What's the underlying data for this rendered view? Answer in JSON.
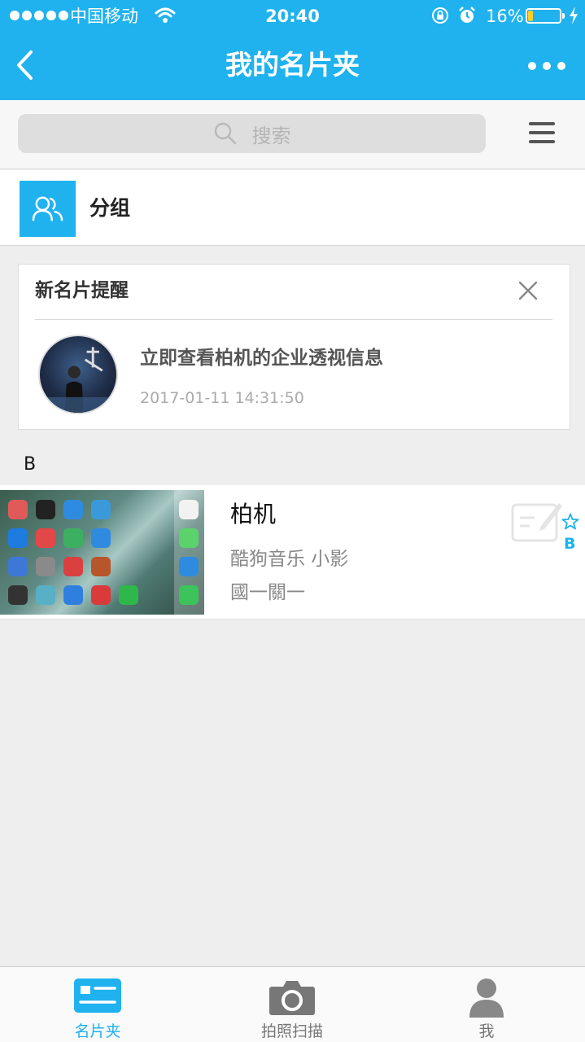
{
  "status_bar": {
    "carrier": "中国移动",
    "time": "20:40",
    "battery_text": "16%",
    "battery_level": 0.16
  },
  "nav": {
    "title": "我的名片夹"
  },
  "search": {
    "placeholder": "搜索"
  },
  "group": {
    "label": "分组"
  },
  "reminder": {
    "title": "新名片提醒",
    "message": "立即查看柏机的企业透视信息",
    "time": "2017-01-11 14:31:50"
  },
  "section_letter": "B",
  "cards": [
    {
      "name": "柏机",
      "line1": "酷狗音乐   小影",
      "line2": "國一關一",
      "star_letter": "B"
    }
  ],
  "tabs": [
    {
      "label": "名片夹",
      "icon": "card-holder-icon",
      "active": true
    },
    {
      "label": "拍照扫描",
      "icon": "camera-icon",
      "active": false
    },
    {
      "label": "我",
      "icon": "person-icon",
      "active": false
    }
  ],
  "colors": {
    "accent": "#1fb2ee",
    "background": "#eeeeee"
  }
}
